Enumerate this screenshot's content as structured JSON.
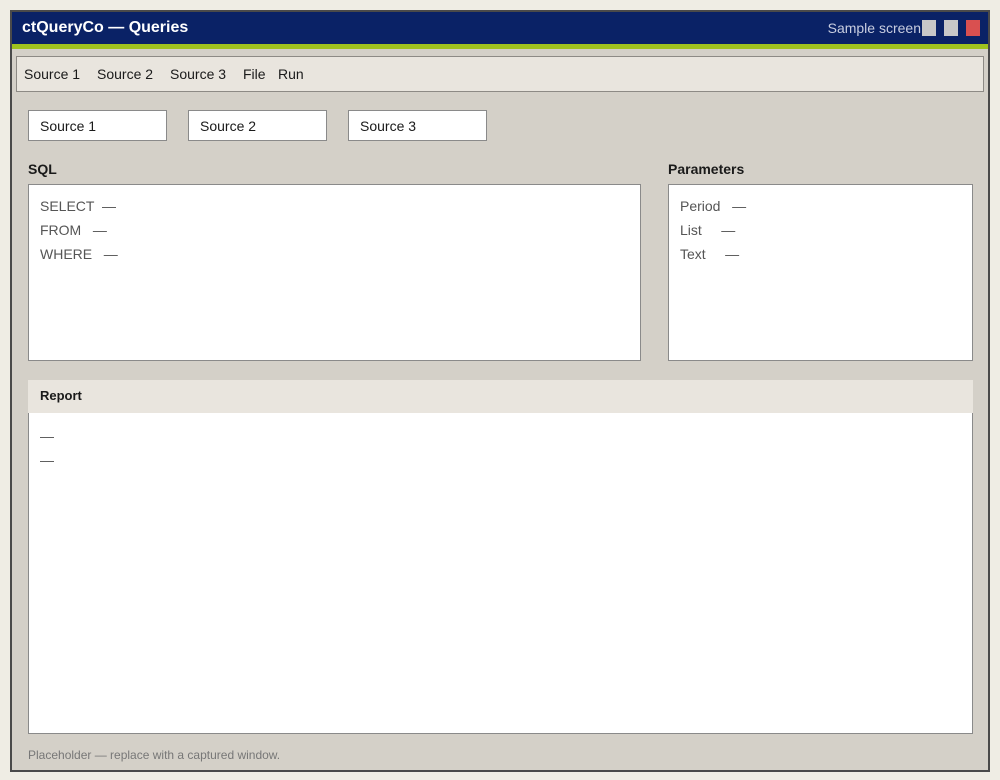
{
  "window": {
    "title": "ctQueryCo — Queries",
    "subtitle": "Sample screen"
  },
  "menu": {
    "items": [
      "Source 1",
      "Source 2",
      "Source 3",
      "File",
      "Run"
    ]
  },
  "sources": [
    "Source 1",
    "Source 2",
    "Source 3"
  ],
  "sql": {
    "heading": "SQL",
    "rows": [
      {
        "label": "SELECT",
        "value": "—"
      },
      {
        "label": "FROM",
        "value": "—"
      },
      {
        "label": "WHERE",
        "value": "—"
      }
    ]
  },
  "parameters": {
    "heading": "Parameters",
    "rows": [
      {
        "label": "Period",
        "value": "—"
      },
      {
        "label": "List",
        "value": "—"
      },
      {
        "label": "Text",
        "value": "—"
      }
    ]
  },
  "report": {
    "heading": "Report",
    "lines": [
      "—",
      "—"
    ]
  },
  "footer": "Placeholder — replace with a captured window.",
  "colors": {
    "titlebar": "#0a2266",
    "accent": "#9fc21f",
    "close": "#d95050"
  }
}
